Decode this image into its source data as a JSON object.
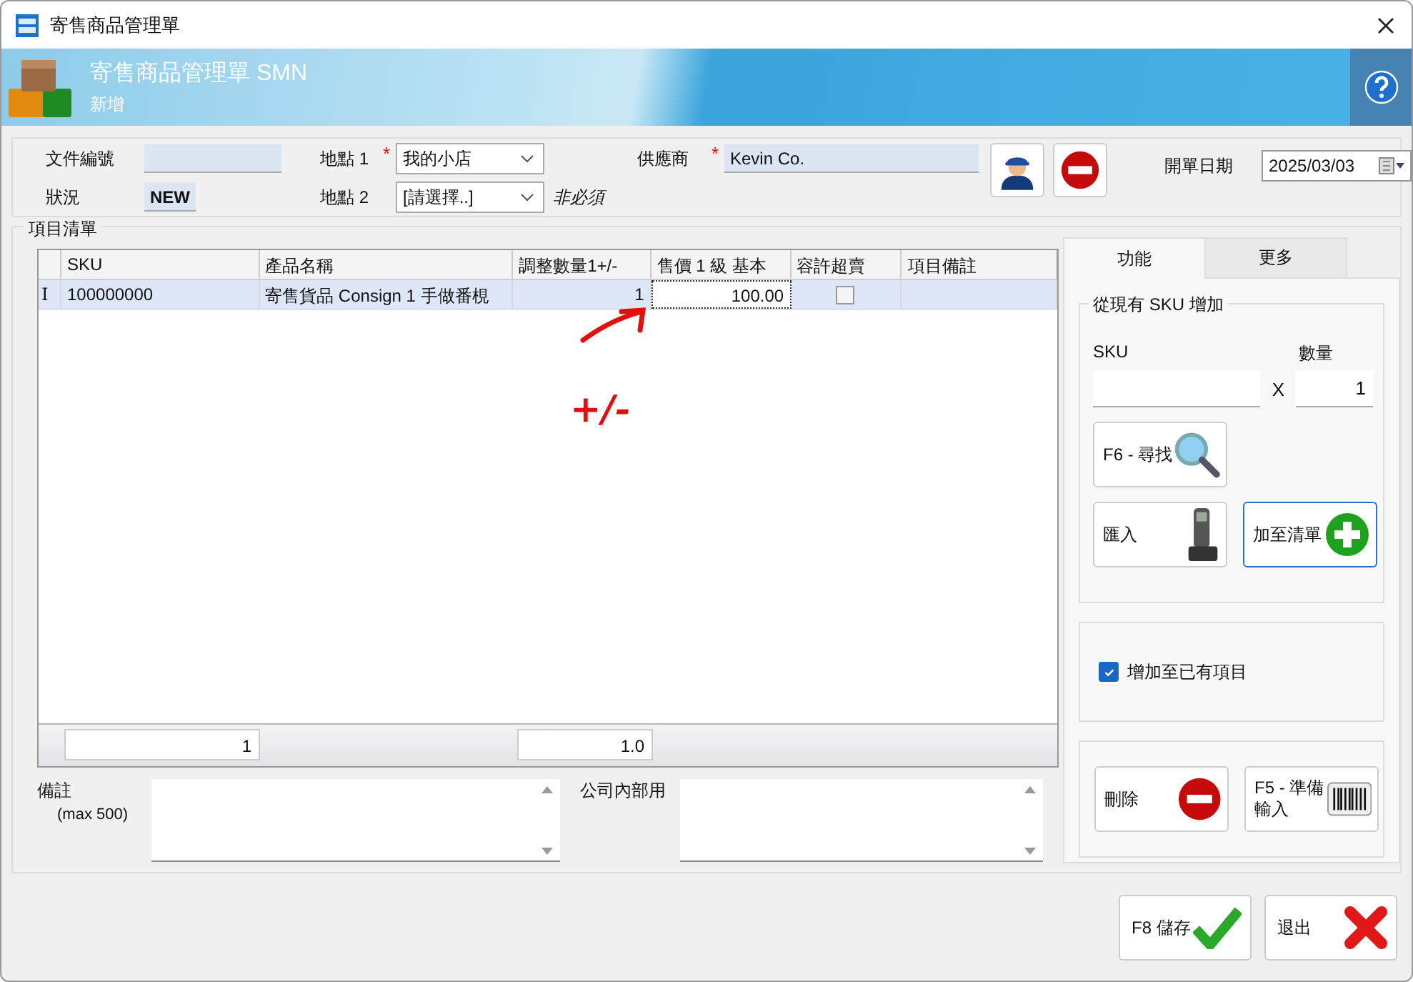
{
  "window": {
    "title": "寄售商品管理單"
  },
  "header": {
    "title": "寄售商品管理單 SMN",
    "subtitle": "新增"
  },
  "form": {
    "doc_no": {
      "label": "文件編號"
    },
    "status": {
      "label": "狀況",
      "value": "NEW"
    },
    "location1": {
      "label": "地點 1",
      "required_mark": "*",
      "value": "我的小店"
    },
    "location2": {
      "label": "地點 2",
      "value": "[請選擇..]",
      "note": "非必須"
    },
    "supplier": {
      "label": "供應商",
      "required_mark": "*",
      "value": "Kevin Co.",
      "buttons": [
        {
          "kind": "person"
        },
        {
          "kind": "minus"
        }
      ]
    },
    "open_date": {
      "label": "開單日期",
      "value": "2025/03/03"
    }
  },
  "items": {
    "title": "項目清單",
    "columns": [
      "SKU",
      "產品名稱",
      "調整數量1+/-",
      "售價 1 級 基本",
      "容許超賣",
      "項目備註"
    ],
    "rows": [
      {
        "selected": true,
        "marker": "I",
        "cells": [
          {
            "kind": "text",
            "text": "100000000"
          },
          {
            "kind": "text",
            "text": "寄售貨品 Consign 1 手做番梘"
          },
          {
            "kind": "number",
            "text": "1"
          },
          {
            "kind": "edit",
            "text": "100.00"
          },
          {
            "kind": "checkbox",
            "checked": false
          },
          {
            "kind": "blank"
          }
        ]
      }
    ],
    "totals": [
      "1",
      "1.0"
    ],
    "annotation": {
      "text": "+/-"
    }
  },
  "notes": [
    {
      "label": "備註",
      "hint": "(max 500)"
    },
    {
      "label": "公司內部用"
    }
  ],
  "side": {
    "tabs": [
      {
        "label": "功能",
        "selected": true
      },
      {
        "label": "更多",
        "selected": false
      }
    ],
    "add_group": {
      "title": "從現有 SKU 增加",
      "sku_label": "SKU",
      "qty_label": "數量",
      "times": "X",
      "qty_value": "1",
      "buttons": [
        {
          "label": "F6 - 尋找",
          "kind": "search",
          "focused": false
        },
        {
          "label": "匯入",
          "kind": "scanner",
          "focused": false
        },
        {
          "label": "加至清單",
          "kind": "plus",
          "focused": true
        }
      ]
    },
    "option": {
      "label": "增加至已有項目",
      "checked": true
    },
    "actions": [
      {
        "label": "刪除",
        "kind": "minus"
      },
      {
        "label": "F5 - 準備輸入",
        "kind": "barcode"
      }
    ]
  },
  "footer_buttons": [
    {
      "label": "F8 儲存",
      "kind": "check"
    },
    {
      "label": "退出",
      "kind": "cross"
    }
  ]
}
